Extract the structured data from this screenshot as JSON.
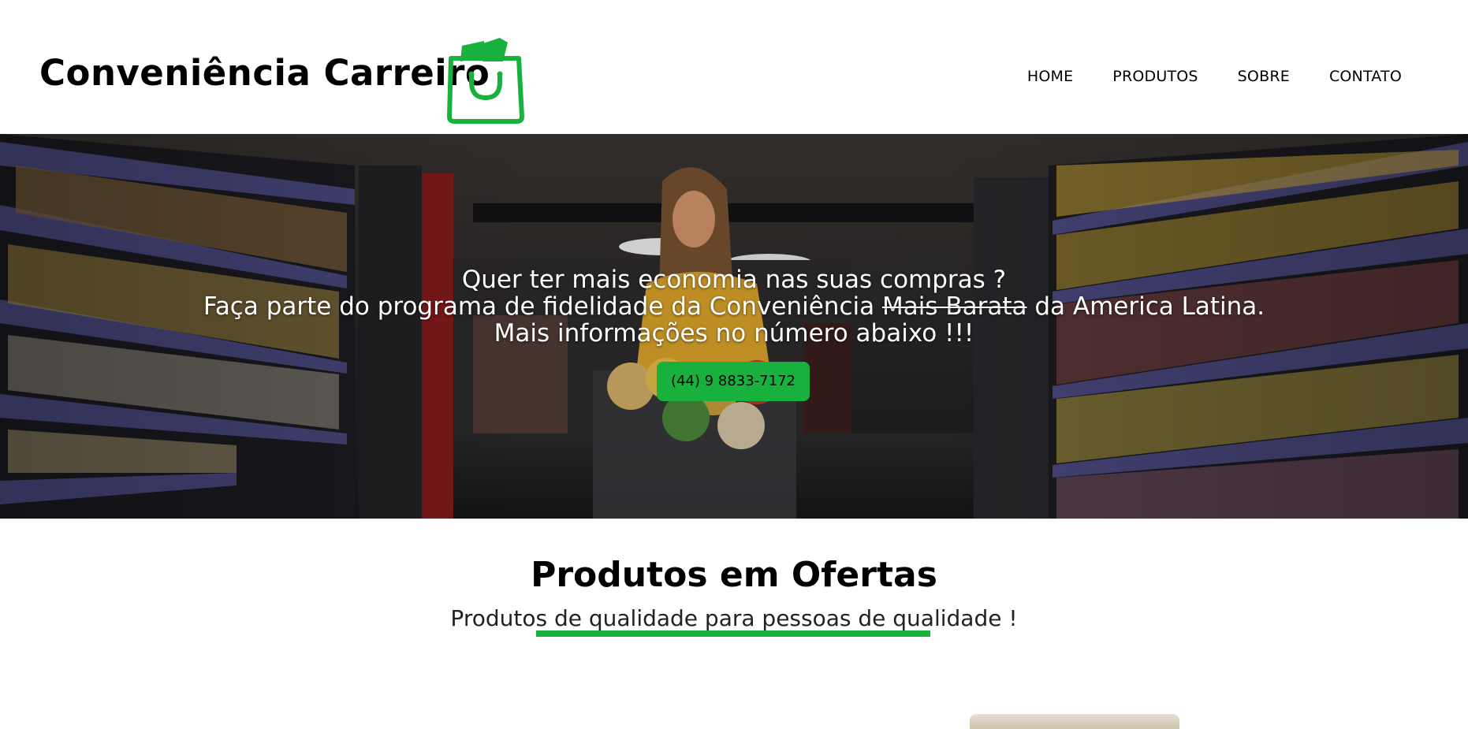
{
  "header": {
    "brand": "Conveniência Carreiro",
    "logo_icon": "shopping-bag-icon",
    "nav": [
      "HOME",
      "PRODUTOS",
      "SOBRE",
      "CONTATO"
    ]
  },
  "hero": {
    "line1": "Quer ter mais economia nas suas compras ?",
    "line2_before": "Faça parte do programa de fidelidade da Conveniência ",
    "line2_strike": "Mais Barata",
    "line2_after": " da America Latina.",
    "line3": "Mais informações no número abaixo !!!",
    "phone_button": "(44) 9 8833-7172"
  },
  "offers": {
    "title": "Produtos em Ofertas",
    "subtitle": "Produtos de qualidade para pessoas de qualidade !"
  },
  "colors": {
    "accent": "#19b13d",
    "text": "#000000",
    "background": "#ffffff"
  }
}
